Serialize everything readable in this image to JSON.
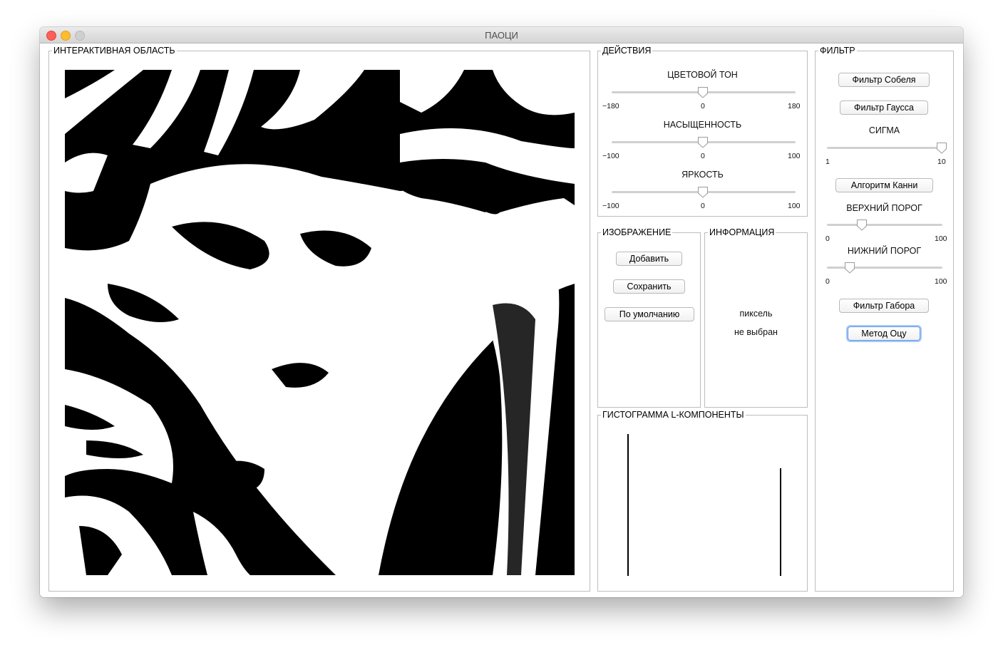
{
  "window": {
    "title": "ПАОЦИ"
  },
  "interactive": {
    "legend": "ИНТЕРАКТИВНАЯ ОБЛАСТЬ"
  },
  "actions": {
    "legend": "ДЕЙСТВИЯ",
    "sliders": [
      {
        "label": "ЦВЕТОВОЙ ТОН",
        "min": "−180",
        "mid": "0",
        "max": "180",
        "value": 0
      },
      {
        "label": "НАСЫЩЕННОСТЬ",
        "min": "−100",
        "mid": "0",
        "max": "100",
        "value": 0
      },
      {
        "label": "ЯРКОСТЬ",
        "min": "−100",
        "mid": "0",
        "max": "100",
        "value": 0
      }
    ]
  },
  "image": {
    "legend": "ИЗОБРАЖЕНИЕ",
    "add": "Добавить",
    "save": "Сохранить",
    "default": "По умолчанию"
  },
  "info": {
    "legend": "ИНФОРМАЦИЯ",
    "line1": "пиксель",
    "line2": "не выбран"
  },
  "histogram": {
    "legend": "ГИСТОГРАММА L-КОМПОНЕНТЫ"
  },
  "filter": {
    "legend": "ФИЛЬТР",
    "sobel": "Фильтр Собеля",
    "gauss": "Фильтр Гаусса",
    "sigma": {
      "label": "СИГМА",
      "min": "1",
      "max": "10",
      "value": 10
    },
    "canny": "Алгоритм Канни",
    "upper": {
      "label": "ВЕРХНИЙ ПОРОГ",
      "min": "0",
      "max": "100",
      "value": 20
    },
    "lower": {
      "label": "НИЖНИЙ ПОРОГ",
      "min": "0",
      "max": "100",
      "value": 12
    },
    "gabor": "Фильтр Габора",
    "otsu": "Метод Оцу"
  }
}
